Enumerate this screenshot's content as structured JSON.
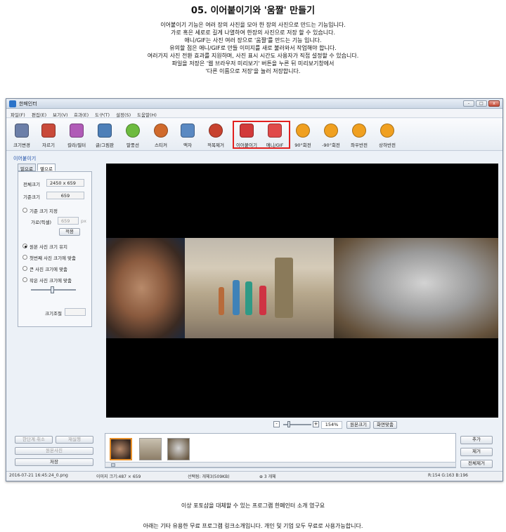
{
  "heading": "05. 이어붙이기와 '움짤' 만들기",
  "intro": [
    "이어붙이기 기능은 여러 장의 사진을 모아 한 장의 사진으로 만드는 기능입니다.",
    "가로 혹은 세로로 길게 나열하여 한장의 사진으로 저장 할 수 있습니다.",
    "애니/GIF는 사진 여러 장으로 '움짤'를 만드는 기능 입니다.",
    "유의할 점은 애니/GIF로 만들 이미지를 새로 불러와서 작업해야 합니다.",
    "여러가지 사진 전환 효과를 지원하며, 사진 표시 시간도 사용자가 직접 설정할 수 있습니다.",
    "파일을 저장은 '웹 브라우저 미리보기' 버튼을 누른 뒤 미리보기창에서",
    "'다른 이름으로 저장'을 눌러 저장합니다."
  ],
  "window": {
    "title": "한페인터",
    "controls": [
      "-",
      "□",
      "x"
    ],
    "menu": [
      "파일(F)",
      "편집(E)",
      "보기(V)",
      "효과(E)",
      "도구(T)",
      "설정(S)",
      "도움말(H)"
    ]
  },
  "toolbar": [
    {
      "label": "크기변경",
      "icon": "resize-icon",
      "color": "#6c7fa8"
    },
    {
      "label": "자르기",
      "icon": "crop-icon",
      "color": "#c94a3a"
    },
    {
      "label": "칼라/필터",
      "icon": "color-filter-icon",
      "color": "#b05bb7"
    },
    {
      "label": "글/그림판",
      "icon": "text-draw-icon",
      "color": "#4d7fb8"
    },
    {
      "label": "말풍선",
      "icon": "speech-bubble-icon",
      "color": "#6dbb3f"
    },
    {
      "label": "스티커",
      "icon": "sticker-icon",
      "color": "#d06a2c"
    },
    {
      "label": "액자",
      "icon": "frame-icon",
      "color": "#5a89c2"
    },
    {
      "label": "적목제거",
      "icon": "red-eye-icon",
      "color": "#c7422f"
    },
    {
      "label": "이어붙이기",
      "icon": "merge-icon",
      "color": "#d23a3a"
    },
    {
      "label": "애니/GIF",
      "icon": "gif-icon",
      "color": "#e04a4a"
    },
    {
      "label": "90°회전",
      "icon": "rotate-right-icon",
      "color": "#f0a020"
    },
    {
      "label": "-90°회전",
      "icon": "rotate-left-icon",
      "color": "#f0a020"
    },
    {
      "label": "좌우반전",
      "icon": "flip-horizontal-icon",
      "color": "#f0a020"
    },
    {
      "label": "상하반전",
      "icon": "flip-vertical-icon",
      "color": "#f0a020"
    }
  ],
  "panel": {
    "title": "이어붙이기",
    "tabs": [
      "밑으로",
      "옆으로"
    ],
    "total_size_label": "전체크기",
    "total_size_value": "2450 x 659",
    "base_size_label": "기준크기",
    "base_size_value": "659",
    "option_fixed": "기준 크기 지정",
    "pixel_label": "가로(픽셀)",
    "pixel_value": "659",
    "pixel_unit": "px",
    "apply": "적용",
    "option_keep": "원본 사진 크기 유지",
    "option_first": "첫번째 사진 크기에 맞춤",
    "option_large": "큰 사진 크기에 맞춤",
    "option_small": "작은 사진 크기에 맞춤",
    "size_adjust_label": "크기조절"
  },
  "bottom_buttons": {
    "undo": "한단계 취소",
    "redo": "재실행",
    "original": "원본사진",
    "save": "저장"
  },
  "zoom": {
    "minus": "-",
    "plus": "+",
    "value": "154%",
    "original_size": "원본크기",
    "fit_screen": "화면맞춤"
  },
  "side_buttons": {
    "add": "추가",
    "remove": "제거",
    "remove_all": "전체제거"
  },
  "status": {
    "file": "2016-07-21 16:45:24_0.png",
    "image_size": "이미지 크기:487 × 659",
    "selected": "선택됨: 개체3(509KB)",
    "count": "⊕ 3 개체",
    "color": "R:154 G:163 B:196"
  },
  "footer": [
    "이상 포토샵을 대체할 수 있는 프로그램 한페인터 소개 였구요",
    "아래는 기타 유용한 무료 프로그램 링크소개입니다. 개인 및 기업 모두 무료로 사용가능합니다."
  ],
  "colors": {
    "highlight": "#e1201f",
    "window_bg": "#ecf1f7",
    "canvas_bg": "#000000"
  }
}
